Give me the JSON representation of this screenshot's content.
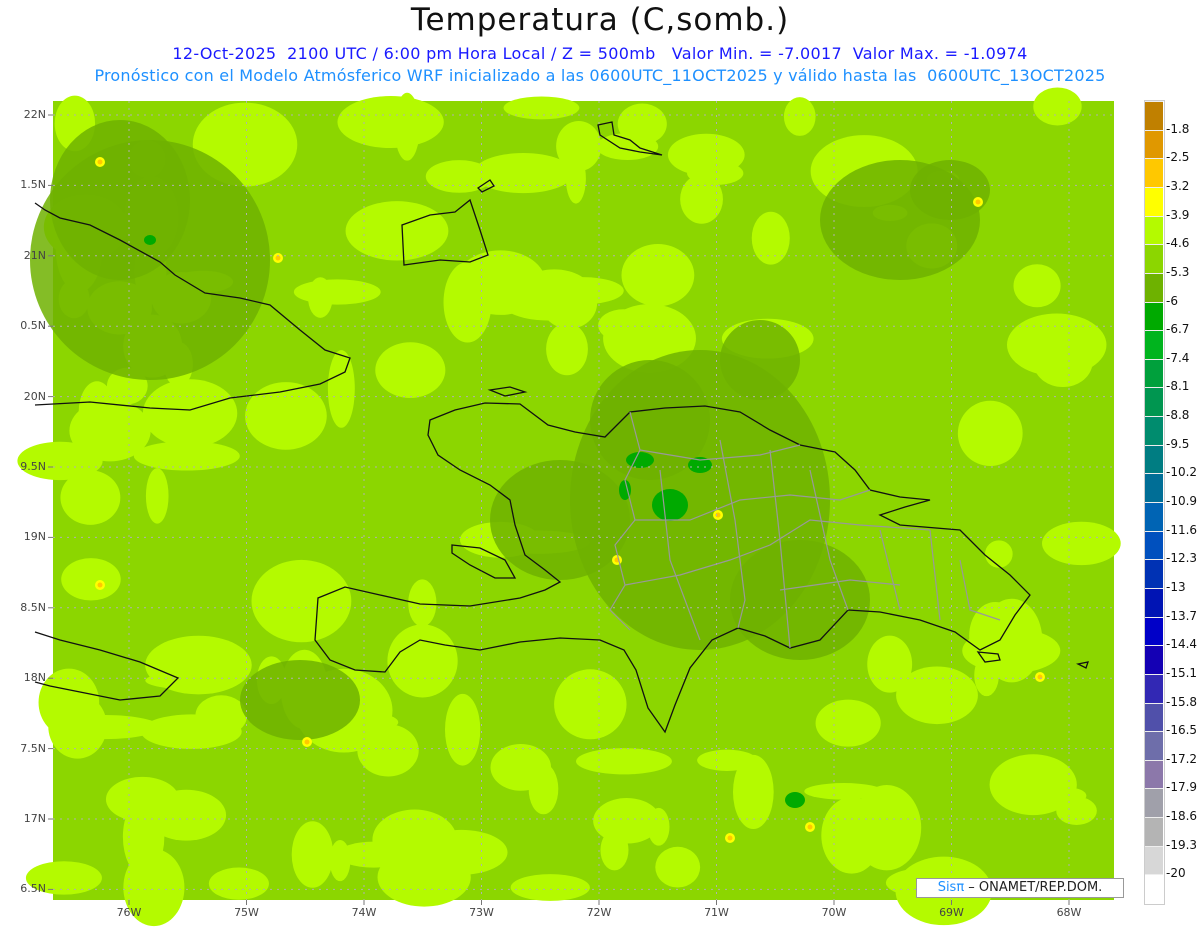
{
  "header": {
    "title": "Temperatura (C,somb.)",
    "line1": "12-Oct-2025  2100 UTC / 6:00 pm Hora Local / Z = 500mb   Valor Min. = -7.0017  Valor Max. = -1.0974",
    "line2": "Pronóstico con el Modelo Atmósferico WRF inicializado a las 0600UTC_11OCT2025 y válido hasta las  0600UTC_13OCT2025"
  },
  "axes": {
    "y_labels": [
      "22N",
      "1.5N",
      "21N",
      "0.5N",
      "20N",
      "9.5N",
      "19N",
      "8.5N",
      "18N",
      "7.5N",
      "17N",
      "6.5N"
    ],
    "x_labels": [
      "76W",
      "75W",
      "74W",
      "73W",
      "72W",
      "71W",
      "70W",
      "69W",
      "68W"
    ]
  },
  "legend": {
    "labels": [
      "-1.8",
      "-2.5",
      "-3.2",
      "-3.9",
      "-4.6",
      "-5.3",
      "-6",
      "-6.7",
      "-7.4",
      "-8.1",
      "-8.8",
      "-9.5",
      "-10.2",
      "-10.9",
      "-11.6",
      "-12.3",
      "-13",
      "-13.7",
      "-14.4",
      "-15.1",
      "-15.8",
      "-16.5",
      "-17.2",
      "-17.9",
      "-18.6",
      "-19.3",
      "-20"
    ],
    "colors": [
      "#c08000",
      "#e09800",
      "#ffc800",
      "#ffff00",
      "#b4fa00",
      "#8cd600",
      "#6eb200",
      "#00aa00",
      "#00b41e",
      "#00a03c",
      "#009650",
      "#008c6e",
      "#007d82",
      "#006e96",
      "#0064b4",
      "#0050be",
      "#0032b4",
      "#0014b4",
      "#0000c8",
      "#1400b4",
      "#3228b4",
      "#5050aa",
      "#6e6eaa",
      "#8c78aa",
      "#a0a0aa",
      "#b4b4b4",
      "#d7d7d7",
      "#ffffff"
    ]
  },
  "credit": {
    "brand": "Sisπ",
    "text": " – ONAMET/REP.DOM."
  }
}
